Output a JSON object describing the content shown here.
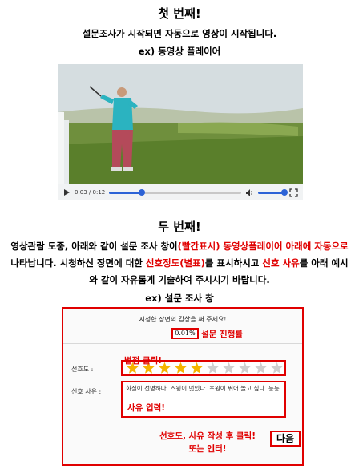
{
  "section1": {
    "title": "첫 번째!",
    "subtitle": "설문조사가 시작되면 자동으로 영상이 시작됩니다.",
    "example": "ex) 동영상 플레이어"
  },
  "video": {
    "time": "0:03 / 0:12",
    "progress": 0.25
  },
  "section2": {
    "title": "두 번째!",
    "p1": "영상관람 도중, 아래와 같이 설문 조사 창이",
    "p1_red": "(빨간표시) 동영상플레이어 아래에 자동으로",
    "p2": " 나타납니다. 시청하신 장면에 대한 ",
    "p2_red": "선호정도(별표)",
    "p3": "를 표시하시고 ",
    "p3_red": "선호 사유",
    "p4": "를 아래 예시와 같이 자유롭게 기술하여 주시시기 바랍니다.",
    "example": "ex) 설문 조사 창"
  },
  "survey": {
    "prompt": "시청한 장면의 감상을 써 주세요!",
    "progress_value": "0.01%",
    "progress_label": "설문 진행률",
    "star_hint": "별점 클릭!",
    "pref_label": "선호도 :",
    "rating": 5,
    "max_rating": 10,
    "reason_label": "선호 사유 :",
    "reason_text": "화질이 선명하다. 스윙이 멋있다. 초원이 뛰어 놀고 싶다. 등등",
    "reason_hint": "사유 입력!",
    "submit_hint_1": "선호도, 사유 작성 후 클릭!",
    "submit_hint_2": "또는 엔터!",
    "next_label": "다음"
  },
  "colors": {
    "accent": "#e00000",
    "star_on": "#f5b400",
    "star_off": "#cfcfcf",
    "player_blue": "#2c63d6"
  }
}
